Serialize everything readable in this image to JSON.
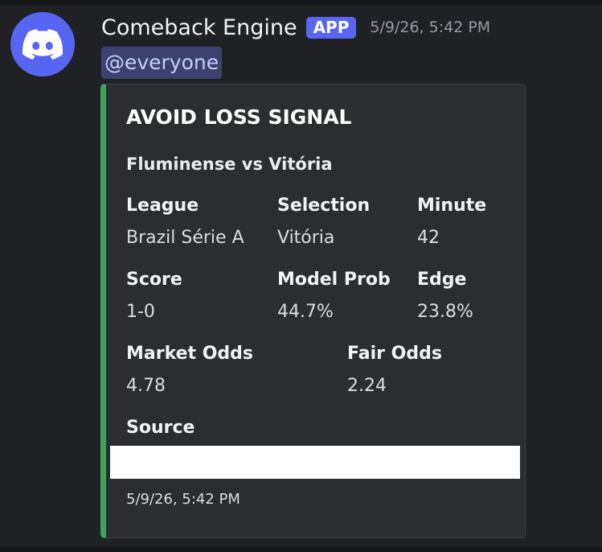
{
  "message": {
    "author": "Comeback Engine",
    "badge": "APP",
    "timestamp": "5/9/26, 5:42 PM",
    "mention": "@everyone"
  },
  "embed": {
    "title": "AVOID LOSS SIGNAL",
    "description": "Fluminense vs Vitória",
    "accent_color": "#3ba55c",
    "fields": {
      "league": {
        "name": "League",
        "value": "Brazil Série A"
      },
      "selection": {
        "name": "Selection",
        "value": "Vitória"
      },
      "minute": {
        "name": "Minute",
        "value": "42"
      },
      "score": {
        "name": "Score",
        "value": "1-0"
      },
      "model_prob": {
        "name": "Model Prob",
        "value": "44.7%"
      },
      "edge": {
        "name": "Edge",
        "value": "23.8%"
      },
      "market_odds": {
        "name": "Market Odds",
        "value": "4.78"
      },
      "fair_odds": {
        "name": "Fair Odds",
        "value": "2.24"
      },
      "source": {
        "name": "Source"
      }
    },
    "footer": "5/9/26, 5:42 PM"
  },
  "colors": {
    "brand": "#5865f2",
    "background": "#202124",
    "embed_background": "#2b2d31"
  },
  "icons": {
    "avatar": "discord-logo-icon"
  }
}
